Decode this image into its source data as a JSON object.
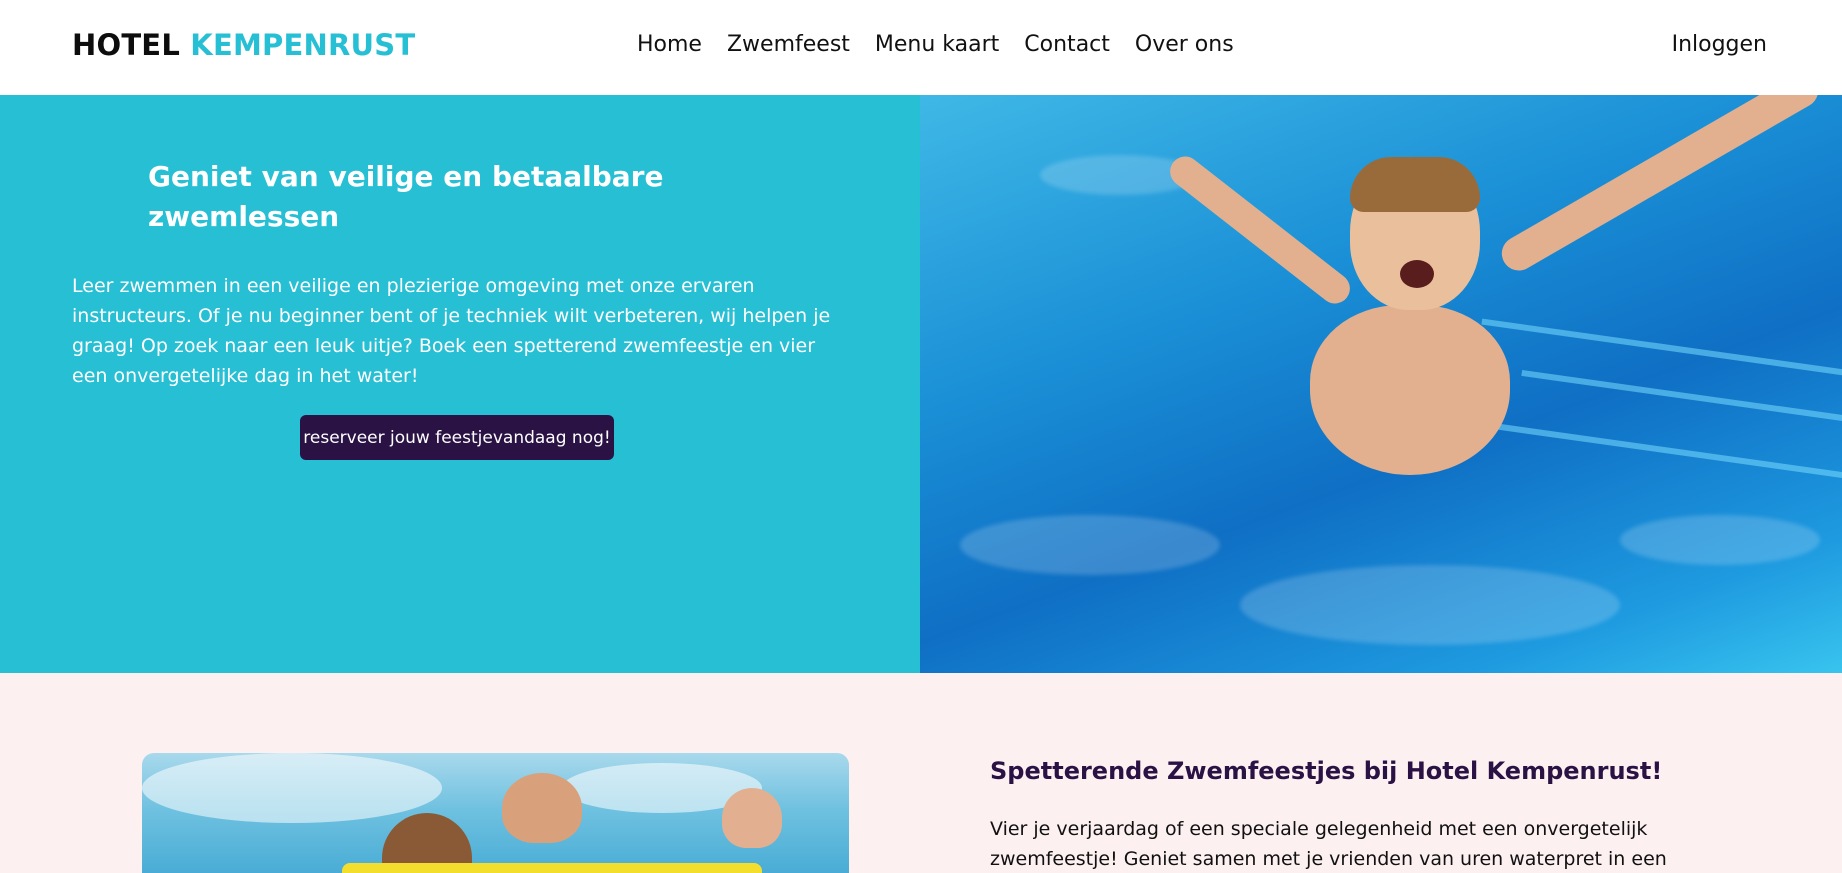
{
  "header": {
    "logo_part1": "HOTEL",
    "logo_part2": "KEMPENRUST",
    "nav": [
      "Home",
      "Zwemfeest",
      "Menu kaart",
      "Contact",
      "Over ons"
    ],
    "login": "Inloggen"
  },
  "hero": {
    "title": "Geniet van veilige en betaalbare zwemlessen",
    "text": "Leer zwemmen in een veilige en plezierige omgeving met onze ervaren instructeurs. Of je nu beginner bent of je techniek wilt verbeteren, wij helpen je graag! Op zoek naar een leuk uitje? Boek een spetterend zwemfeestje en vier een onvergetelijke dag in het water!",
    "button": "reserveer jouw feestjevandaag nog!"
  },
  "section2": {
    "title": "Spetterende Zwemfeestjes bij Hotel Kempenrust!",
    "text": "Vier je verjaardag of een speciale gelegenheid met een onvergetelijk zwemfeestje! Geniet samen met je vrienden van uren waterpret in een veilige en"
  },
  "colors": {
    "accent": "#26bfd4",
    "button_bg": "#2a1245",
    "section2_bg": "#fcf0f1"
  }
}
